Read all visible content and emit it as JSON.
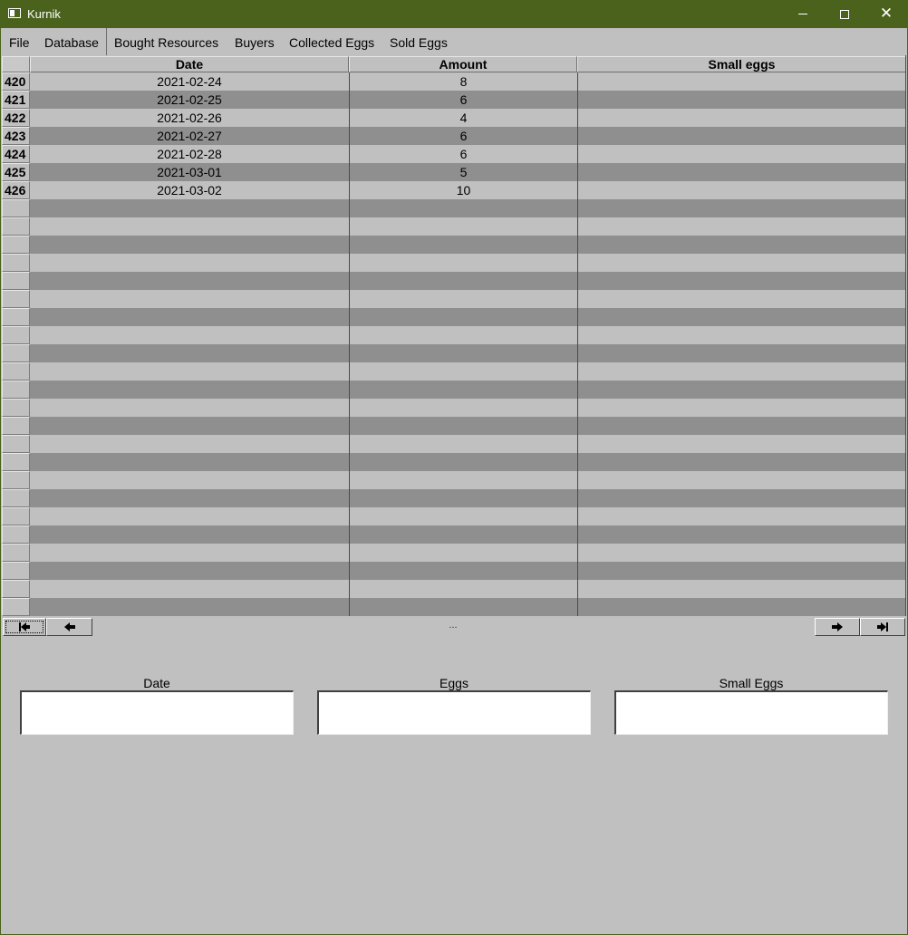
{
  "window": {
    "title": "Kurnik"
  },
  "menu": [
    "File",
    "Database",
    "Bought Resources",
    "Buyers",
    "Collected Eggs",
    "Sold Eggs"
  ],
  "table": {
    "columns": [
      "Date",
      "Amount",
      "Small eggs"
    ],
    "rows": [
      {
        "id": "420",
        "date": "2021-02-24",
        "amount": "8",
        "small": ""
      },
      {
        "id": "421",
        "date": "2021-02-25",
        "amount": "6",
        "small": ""
      },
      {
        "id": "422",
        "date": "2021-02-26",
        "amount": "4",
        "small": ""
      },
      {
        "id": "423",
        "date": "2021-02-27",
        "amount": "6",
        "small": ""
      },
      {
        "id": "424",
        "date": "2021-02-28",
        "amount": "6",
        "small": ""
      },
      {
        "id": "425",
        "date": "2021-03-01",
        "amount": "5",
        "small": ""
      },
      {
        "id": "426",
        "date": "2021-03-02",
        "amount": "10",
        "small": ""
      }
    ]
  },
  "nav": {
    "status": "..."
  },
  "form": {
    "date_label": "Date",
    "eggs_label": "Eggs",
    "small_eggs_label": "Small Eggs",
    "date_value": "",
    "eggs_value": "",
    "small_eggs_value": ""
  },
  "colors": {
    "titlebar": "#4a621c",
    "row_light": "#c0c0c0",
    "row_dark": "#8f8f8f",
    "background": "#c0c0c0"
  },
  "icons": [
    "window-app-icon",
    "minimize-icon",
    "maximize-icon",
    "close-icon",
    "first-record-icon",
    "prev-record-icon",
    "next-record-icon",
    "last-record-icon"
  ]
}
